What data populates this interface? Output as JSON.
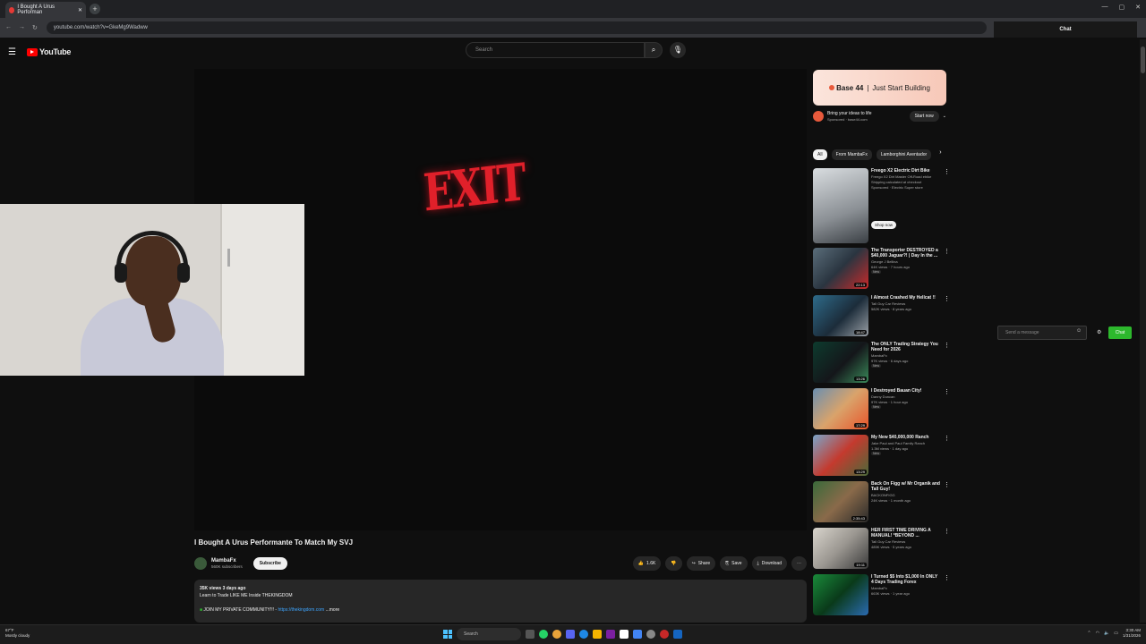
{
  "browser": {
    "tab_title": "I Bought A Urus Performan",
    "url": "youtube.com/watch?v=GkeMg9Wadww"
  },
  "youtube": {
    "logo_text": "YouTube",
    "search_placeholder": "Search"
  },
  "player": {
    "sign_text": "EXIT"
  },
  "video": {
    "title": "I Bought A Urus Performante To Match My SVJ",
    "channel": "MambaFx",
    "subscribers": "560K subscribers",
    "subscribe_label": "Subscribe",
    "like_count": "1.6K",
    "share_label": "Share",
    "save_label": "Save",
    "download_label": "Download",
    "description": {
      "meta": "35K views  3 days ago",
      "line1": "Learn to Trade LIKE ME Inside THEKINGDOM",
      "line2_prefix": "JOIN MY PRIVATE COMMUNITY!!! - ",
      "link": "https://thekingdom.com",
      "more": "...more"
    }
  },
  "ad": {
    "brand": "Base 44",
    "tagline": "Just Start Building",
    "headline": "Bring your ideas to life",
    "sponsored": "Sponsored · base44.com",
    "cta": "Start now"
  },
  "chips": [
    {
      "label": "All"
    },
    {
      "label": "From MambaFx"
    },
    {
      "label": "Lamborghini Aventador"
    }
  ],
  "recommendations": [
    {
      "title": "Freego X2 Electric Dirt Bike",
      "channel": "Freego X2 Dirt Master Off-Road ebike",
      "meta": "Shipping calculated at checkout",
      "badge": "Sponsored · Electric Super store",
      "duration": "",
      "shop": "Shop now"
    },
    {
      "title": "The Transporter DESTROYED a $40,000 Jaguar?! | Day In the ...",
      "channel": "George J Bellina",
      "meta": "64K views · 7 hours ago",
      "badge": "New",
      "duration": "22:13",
      "shop": ""
    },
    {
      "title": "I Almost Crashed My Hellcat !!",
      "channel": "Tall Guy Car Reviews",
      "meta": "582K views · 8 years ago",
      "badge": "",
      "duration": "18:47",
      "shop": ""
    },
    {
      "title": "The ONLY Trading Strategy You Need for 2026",
      "channel": "MambaFx",
      "meta": "97K views · 6 days ago",
      "badge": "New",
      "duration": "13:26",
      "shop": ""
    },
    {
      "title": "I Destroyed Bauan City!",
      "channel": "Danny Duncan",
      "meta": "97K views · 1 hour ago",
      "badge": "New",
      "duration": "17:29",
      "shop": ""
    },
    {
      "title": "My New $40,000,000 Ranch",
      "channel": "Jake Paul and Paul Family Ranch",
      "meta": "1.3M views · 1 day ago",
      "badge": "New",
      "duration": "13:29",
      "shop": ""
    },
    {
      "title": "Back On Figg w/ Mr Organik and Tall Guy!",
      "channel": "BACKONFIGG",
      "meta": "24K views · 1 month ago",
      "badge": "",
      "duration": "2:35:43",
      "shop": ""
    },
    {
      "title": "HER FIRST TIME DRIVING A MANUAL! *BEYOND ...",
      "channel": "Tall Guy Car Reviews",
      "meta": "485K views · 5 years ago",
      "badge": "",
      "duration": "19:11",
      "shop": ""
    },
    {
      "title": "I Turned $5 Into $1,000 In ONLY 4 Days Trading Forex",
      "channel": "MambaFx",
      "meta": "663K views · 1 year ago",
      "badge": "",
      "duration": "",
      "shop": ""
    }
  ],
  "chat": {
    "header": "Chat",
    "input_placeholder": "Send a message",
    "send_label": "Chat"
  },
  "taskbar": {
    "weather_temp": "67°F",
    "weather_desc": "Mostly cloudy",
    "search_label": "Search",
    "time": "3:30 AM",
    "date": "1/31/2026"
  }
}
